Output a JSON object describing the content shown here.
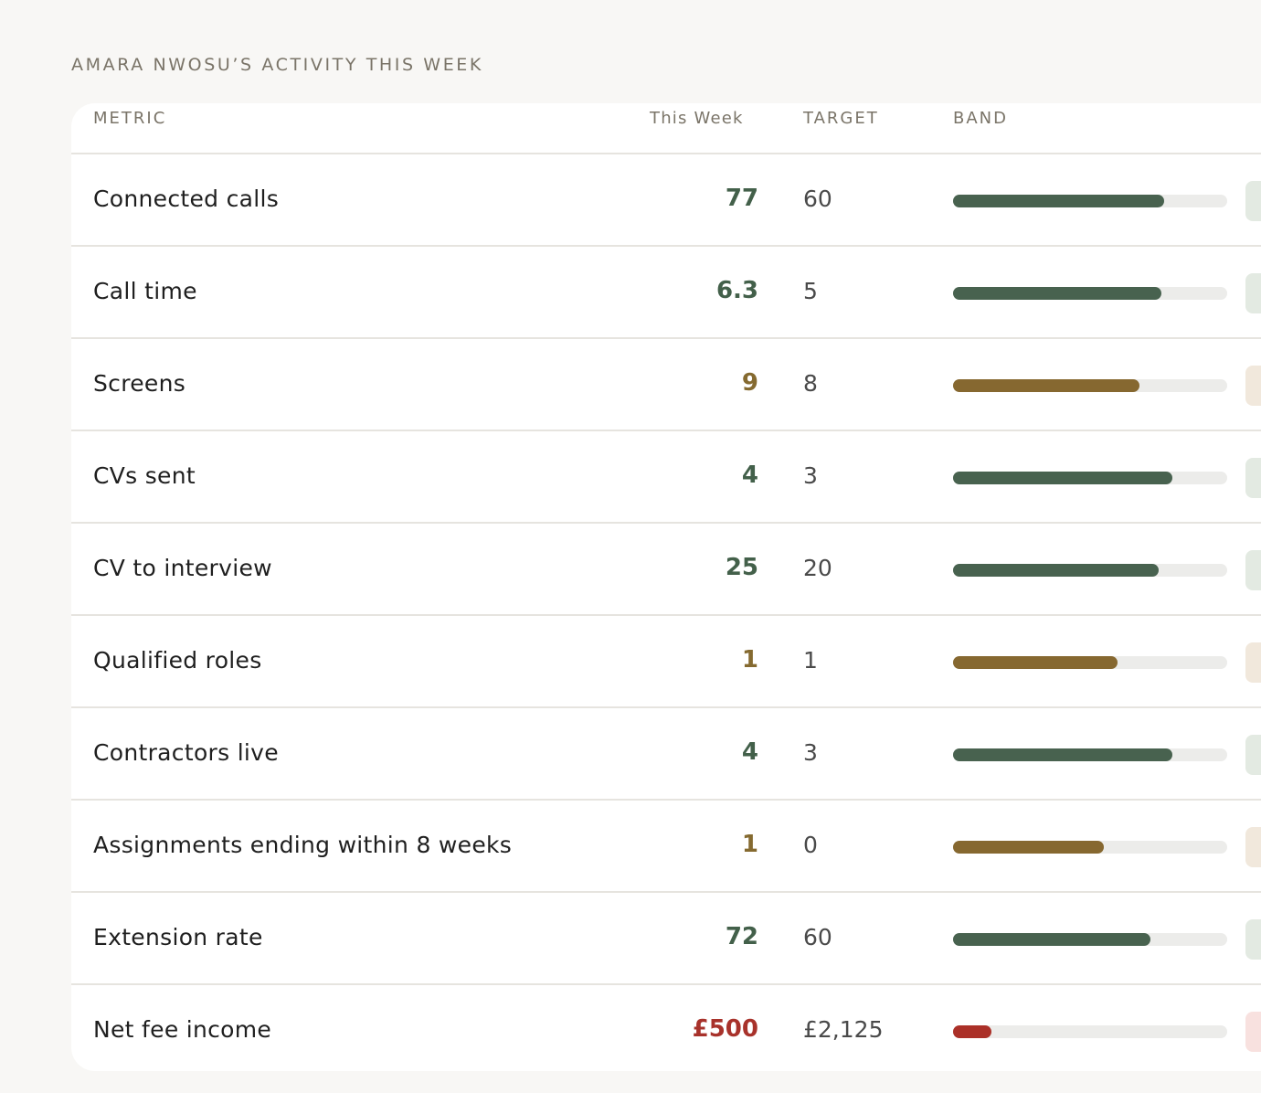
{
  "section_title": "AMARA NWOSU’S ACTIVITY THIS WEEK",
  "table": {
    "headers": {
      "metric": "METRIC",
      "this_week": "This Week",
      "target": "TARGET",
      "band": "BAND"
    },
    "rows": [
      {
        "metric": "Connected calls",
        "this_week": "77",
        "target": "60",
        "band_fill": 0.77,
        "status": "good"
      },
      {
        "metric": "Call time",
        "this_week": "6.3",
        "target": "5",
        "band_fill": 0.76,
        "status": "good"
      },
      {
        "metric": "Screens",
        "this_week": "9",
        "target": "8",
        "band_fill": 0.68,
        "status": "warn"
      },
      {
        "metric": "CVs sent",
        "this_week": "4",
        "target": "3",
        "band_fill": 0.8,
        "status": "good"
      },
      {
        "metric": "CV to interview",
        "this_week": "25",
        "target": "20",
        "band_fill": 0.75,
        "status": "good"
      },
      {
        "metric": "Qualified roles",
        "this_week": "1",
        "target": "1",
        "band_fill": 0.6,
        "status": "warn"
      },
      {
        "metric": "Contractors live",
        "this_week": "4",
        "target": "3",
        "band_fill": 0.8,
        "status": "good"
      },
      {
        "metric": "Assignments ending within 8 weeks",
        "this_week": "1",
        "target": "0",
        "band_fill": 0.55,
        "status": "warn"
      },
      {
        "metric": "Extension rate",
        "this_week": "72",
        "target": "60",
        "band_fill": 0.72,
        "status": "good"
      },
      {
        "metric": "Net fee income",
        "this_week": "£500",
        "target": "£2,125",
        "band_fill": 0.14,
        "status": "bad"
      }
    ]
  },
  "status_colors": {
    "good": {
      "text": "#43604a",
      "bar": "#48624f",
      "chip": "#e3eae2"
    },
    "warn": {
      "text": "#856a30",
      "bar": "#866830",
      "chip": "#f1e8dc"
    },
    "bad": {
      "text": "#a8322b",
      "bar": "#ab3028",
      "chip": "#f8e1df"
    }
  }
}
